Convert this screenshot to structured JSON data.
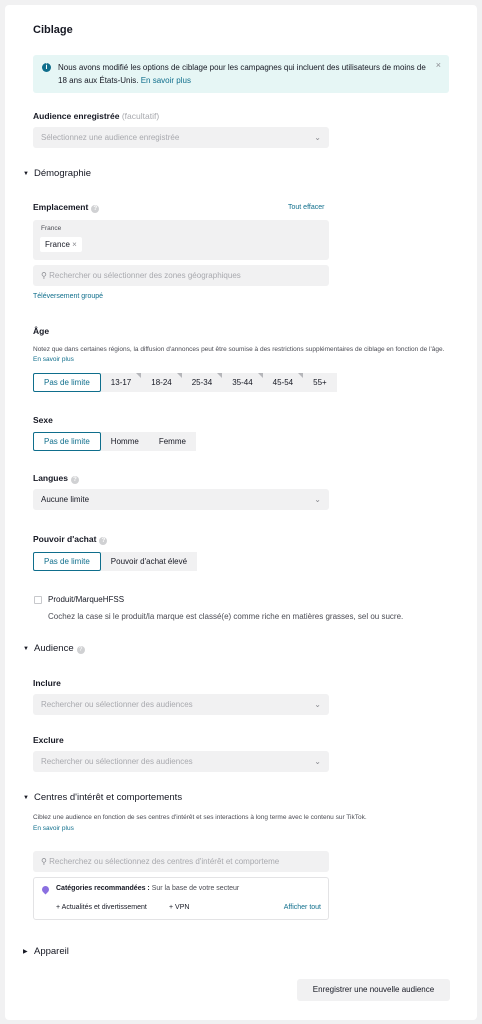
{
  "title": "Ciblage",
  "notice": {
    "text": "Nous avons modifié les options de ciblage pour les campagnes qui incluent des utilisateurs de moins de 18 ans aux États-Unis.",
    "link": "En savoir plus",
    "close": "×"
  },
  "saved_audience": {
    "label": "Audience enregistrée",
    "optional": "(facultatif)",
    "placeholder": "Sélectionnez une audience enregistrée"
  },
  "demography": {
    "header": "Démographie",
    "location": {
      "label": "Emplacement",
      "clear_all": "Tout effacer",
      "group_title": "France",
      "tag": "France",
      "tag_remove": "×",
      "search_placeholder": "Rechercher ou sélectionner des zones géographiques",
      "bulk_upload": "Téléversement groupé"
    },
    "age": {
      "label": "Âge",
      "note": "Notez que dans certaines régions, la diffusion d'annonces peut être soumise à des restrictions supplémentaires de ciblage en fonction de l'âge.",
      "note_link": "En savoir plus",
      "options": [
        "Pas de limite",
        "13-17",
        "18-24",
        "25-34",
        "35-44",
        "45-54",
        "55+"
      ]
    },
    "gender": {
      "label": "Sexe",
      "options": [
        "Pas de limite",
        "Homme",
        "Femme"
      ]
    },
    "languages": {
      "label": "Langues",
      "value": "Aucune limite"
    },
    "purchasing_power": {
      "label": "Pouvoir d'achat",
      "options": [
        "Pas de limite",
        "Pouvoir d'achat élevé"
      ]
    },
    "hfss": {
      "label": "Produit/MarqueHFSS",
      "description": "Cochez la case si le produit/la marque est classé(e) comme riche en matières grasses, sel ou sucre."
    }
  },
  "audience": {
    "header": "Audience",
    "include_label": "Inclure",
    "include_placeholder": "Rechercher ou sélectionner des audiences",
    "exclude_label": "Exclure",
    "exclude_placeholder": "Rechercher ou sélectionner des audiences"
  },
  "interests": {
    "header": "Centres d'intérêt et comportements",
    "description": "Ciblez une audience en fonction de ses centres d'intérêt et ses interactions à long terme avec le contenu sur TikTok.",
    "link": "En savoir plus",
    "search_placeholder": "Recherchez ou sélectionnez des centres d'intérêt et comporteme",
    "recommended_label": "Catégories recommandées :",
    "recommended_hint": "Sur la base de votre secteur",
    "chips": [
      "+ Actualités et divertissement",
      "+ VPN"
    ],
    "show_all": "Afficher tout"
  },
  "device": {
    "header": "Appareil"
  },
  "save_button": "Enregistrer une nouvelle audience",
  "colors": {
    "accent": "#0f6e8c",
    "notice_bg": "#e6f6f5",
    "field_bg": "#f1f1f2"
  }
}
